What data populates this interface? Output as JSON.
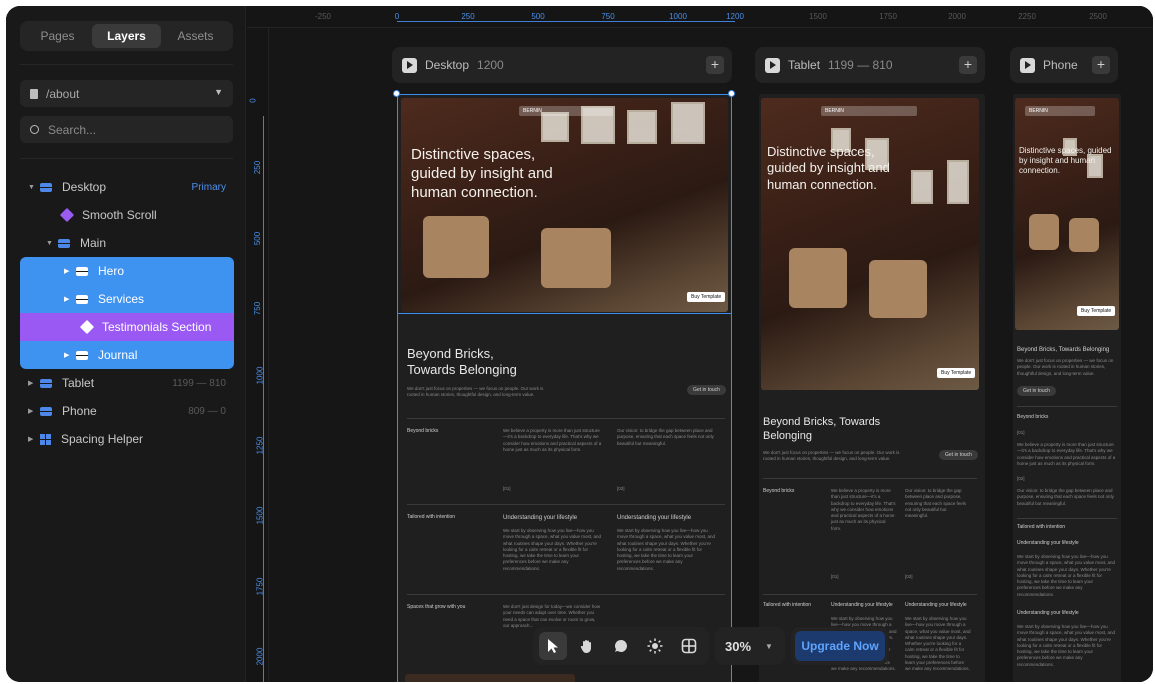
{
  "sidebar": {
    "tabs": [
      {
        "label": "Pages"
      },
      {
        "label": "Layers",
        "active": true
      },
      {
        "label": "Assets"
      }
    ],
    "page_selector": {
      "value": "/about"
    },
    "search": {
      "placeholder": "Search..."
    },
    "layers": [
      {
        "label": "Desktop",
        "tag": "Primary",
        "icon": "stack-icon"
      },
      {
        "label": "Smooth Scroll",
        "icon": "component-icon"
      },
      {
        "label": "Main",
        "icon": "stack-icon"
      },
      {
        "label": "Hero",
        "icon": "stack-icon",
        "selected": true
      },
      {
        "label": "Services",
        "icon": "stack-icon",
        "selected": true
      },
      {
        "label": "Testimonials Section",
        "icon": "component-icon",
        "selected": true
      },
      {
        "label": "Journal",
        "icon": "stack-icon",
        "selected": true
      },
      {
        "label": "Tablet",
        "meta": "1199 — 810",
        "icon": "stack-icon"
      },
      {
        "label": "Phone",
        "meta": "809 — 0",
        "icon": "stack-icon"
      },
      {
        "label": "Spacing Helper",
        "icon": "grid-icon"
      }
    ]
  },
  "canvas": {
    "ruler_top": [
      "-250",
      "0",
      "250",
      "500",
      "750",
      "1000",
      "1200",
      "1500",
      "1750",
      "2000",
      "2250",
      "2500"
    ],
    "ruler_left": [
      "0",
      "250",
      "500",
      "750",
      "1000",
      "1250",
      "1500",
      "1750",
      "2000"
    ],
    "frames": {
      "desktop": {
        "name": "Desktop",
        "width": "1200"
      },
      "tablet": {
        "name": "Tablet",
        "range": "1199 — 810"
      },
      "phone": {
        "name": "Phone"
      }
    },
    "content": {
      "hero_title_desktop": "Distinctive spaces, guided by insight and human connection.",
      "hero_title_tablet": "Distinctive spaces, guided by insight and human connection.",
      "hero_title_phone": "Distinctive spaces, guided by insight and human connection.",
      "hero_button": "Buy Template",
      "nav_label": "BERNIN",
      "section_title": "Beyond Bricks, Towards Belonging",
      "section_body": "We don't just focus on properties — we focus on people. Our work is rooted in human stories, thoughtful design, and long-term value.",
      "get_in_touch": "Get in touch",
      "row1_label": "Beyond bricks",
      "row1_col1": "We believe a property is more than just structure—it's a backdrop to everyday life. That's why we consider how emotions and practical aspects of a home just as much as its physical form.",
      "row1_col2": "Our vision: to bridge the gap between place and purpose, ensuring that each space feels not only beautiful but meaningful.",
      "row1_num1": "[01]",
      "row1_num2": "[02]",
      "row2_label": "Tailored with intention",
      "row2_h1": "Understanding your lifestyle",
      "row2_h2": "Understanding your lifestyle",
      "row2_body": "We start by observing how you live—how you move through a space, what you value most, and what routines shape your days. Whether you're looking for a calm retreat or a flexible fit for hosting, we take the time to learn your preferences before we make any recommendations.",
      "row3_label": "Spaces that grow with you",
      "row3_body": "We don't just design for today—we consider how your needs can adapt over time. Whether you need a space that can evolve or room to grow, our approach..."
    }
  },
  "toolbar": {
    "tools": [
      {
        "name": "pointer-icon",
        "active": true
      },
      {
        "name": "hand-icon"
      },
      {
        "name": "comment-icon"
      },
      {
        "name": "theme-icon"
      },
      {
        "name": "grid-icon"
      }
    ],
    "zoom": "30%",
    "upgrade": "Upgrade Now"
  }
}
